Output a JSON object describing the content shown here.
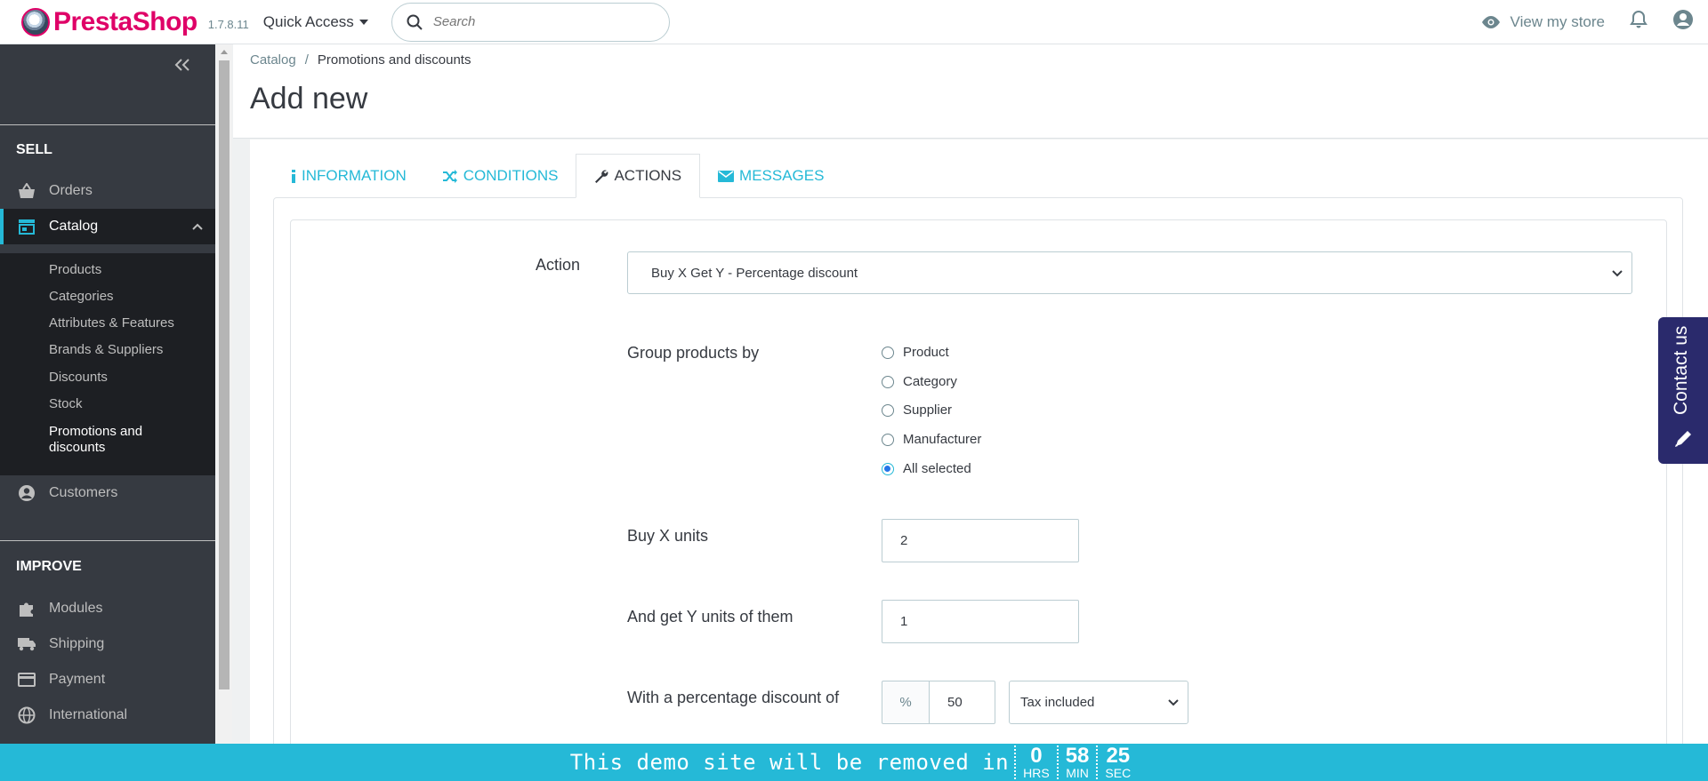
{
  "header": {
    "brand_presta": "Presta",
    "brand_shop": "Shop",
    "version": "1.7.8.11",
    "quick_access": "Quick Access",
    "search_placeholder": "Search",
    "view_store": "View my store"
  },
  "sidebar": {
    "sell_heading": "SELL",
    "improve_heading": "IMPROVE",
    "orders": "Orders",
    "catalog": "Catalog",
    "customers": "Customers",
    "modules": "Modules",
    "shipping": "Shipping",
    "payment": "Payment",
    "international": "International",
    "catalog_submenu": [
      "Products",
      "Categories",
      "Attributes & Features",
      "Brands & Suppliers",
      "Discounts",
      "Stock",
      "Promotions and discounts"
    ]
  },
  "breadcrumb": {
    "parent": "Catalog",
    "separator": "/",
    "current": "Promotions and discounts"
  },
  "page_title": "Add new",
  "tabs": {
    "information": "INFORMATION",
    "conditions": "CONDITIONS",
    "actions": "ACTIONS",
    "messages": "MESSAGES",
    "active": "ACTIONS"
  },
  "form": {
    "action_label": "Action",
    "action_value": "Buy X Get Y - Percentage discount",
    "group_label": "Group products by",
    "group_options": [
      "Product",
      "Category",
      "Supplier",
      "Manufacturer",
      "All selected"
    ],
    "group_selected": "All selected",
    "buy_x_label": "Buy X units",
    "buy_x_value": "2",
    "get_y_label": "And get Y units of them",
    "get_y_value": "1",
    "percent_label": "With a percentage discount of",
    "percent_addon": "%",
    "percent_value": "50",
    "tax_value": "Tax included"
  },
  "contact_tab": "Contact us",
  "demo_banner": {
    "text": "This demo site will be removed in",
    "hours": "0",
    "hours_unit": "HRS",
    "minutes": "58",
    "minutes_unit": "MIN",
    "seconds": "25",
    "seconds_unit": "SEC"
  },
  "colors": {
    "accent": "#25b9d7",
    "brand": "#df0067",
    "sidebar_bg": "#363a41",
    "sidebar_active": "#1d1f23",
    "contact_bg": "#2a2a6c"
  }
}
